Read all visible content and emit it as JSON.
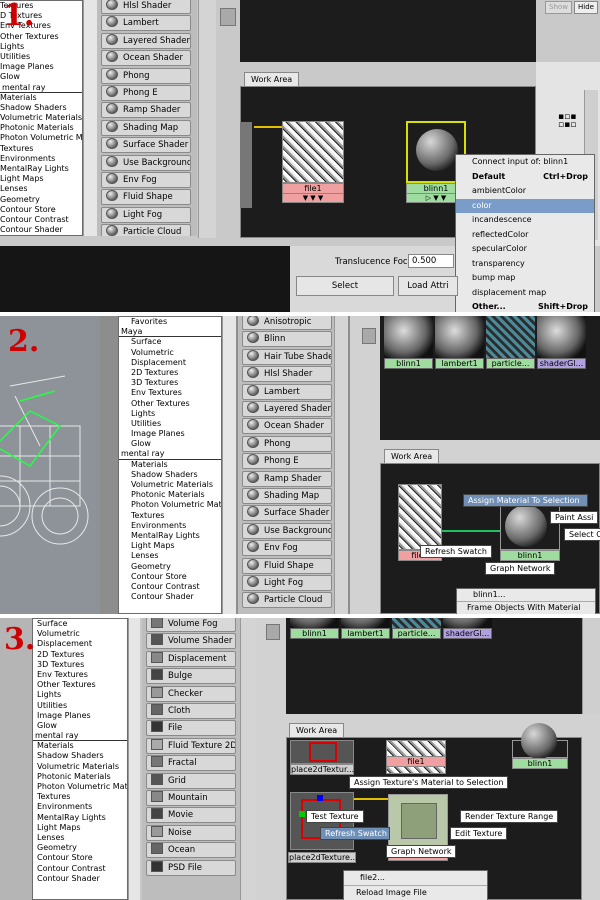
{
  "panel1": {
    "step": "1.",
    "tree": [
      "Textures",
      "D Textures",
      "Env Textures",
      "Other Textures",
      "Lights",
      "Utilities",
      "Image Planes",
      "Glow",
      "mental ray",
      "Materials",
      "Shadow Shaders",
      "Volumetric Materials",
      "Photonic Materials",
      "Photon Volumetric Mat...",
      "Textures",
      "Environments",
      "MentalRay Lights",
      "Light Maps",
      "Lenses",
      "Geometry",
      "Contour Store",
      "Contour Contrast",
      "Contour Shader"
    ],
    "buttons": [
      "Hlsl Shader",
      "Lambert",
      "Layered Shader",
      "Ocean Shader",
      "Phong",
      "Phong E",
      "Ramp Shader",
      "Shading Map",
      "Surface Shader",
      "Use Background",
      "Env Fog",
      "Fluid Shape",
      "Light Fog",
      "Particle Cloud"
    ],
    "top_buttons": [
      "Show",
      "Hide"
    ],
    "work_area": "Work Area",
    "node_file": "file1",
    "node_blinn": "blinn1",
    "menu": {
      "title": "Connect input of: blinn1",
      "default": "Default",
      "default_key": "Ctrl+Drop",
      "items": [
        "ambientColor",
        "color",
        "incandescence",
        "reflectedColor",
        "specularColor",
        "transparency",
        "bump map",
        "displacement map"
      ],
      "other": "Other...",
      "other_key": "Shift+Drop"
    },
    "translucence_label": "Translucence Focus",
    "translucence_value": "0.500",
    "select": "Select",
    "load": "Load Attri"
  },
  "panel2": {
    "step": "2.",
    "tree": [
      "Favorites",
      "Maya",
      "Surface",
      "Volumetric",
      "Displacement",
      "2D Textures",
      "3D Textures",
      "Env Textures",
      "Other Textures",
      "Lights",
      "Utilities",
      "Image Planes",
      "Glow",
      "mental ray",
      "Materials",
      "Shadow Shaders",
      "Volumetric Materials",
      "Photonic Materials",
      "Photon Volumetric Mat...",
      "Textures",
      "Environments",
      "MentalRay Lights",
      "Light Maps",
      "Lenses",
      "Geometry",
      "Contour Store",
      "Contour Contrast",
      "Contour Shader"
    ],
    "buttons": [
      "Anisotropic",
      "Blinn",
      "Hair Tube Shader",
      "Hlsl Shader",
      "Lambert",
      "Layered Shader",
      "Ocean Shader",
      "Phong",
      "Phong E",
      "Ramp Shader",
      "Shading Map",
      "Surface Shader",
      "Use Background",
      "Env Fog",
      "Fluid Shape",
      "Light Fog",
      "Particle Cloud"
    ],
    "swatches": [
      "blinn1",
      "lambert1",
      "particle...",
      "shaderGl..."
    ],
    "work_area": "Work Area",
    "node_file": "file1",
    "node_blinn": "blinn1",
    "tips": {
      "assign": "Assign Material To Selection",
      "paint": "Paint Assi",
      "refresh": "Refresh Swatch",
      "select": "Select O",
      "graph": "Graph Network"
    },
    "menu": [
      "blinn1...",
      "Frame Objects With Material"
    ]
  },
  "panel3": {
    "step": "3.",
    "tree": [
      "Surface",
      "Volumetric",
      "Displacement",
      "2D Textures",
      "3D Textures",
      "Env Textures",
      "Other Textures",
      "Lights",
      "Utilities",
      "Image Planes",
      "Glow",
      "mental ray",
      "Materials",
      "Shadow Shaders",
      "Volumetric Materials",
      "Photonic Materials",
      "Photon Volumetric Mat...",
      "Textures",
      "Environments",
      "MentalRay Lights",
      "Light Maps",
      "Lenses",
      "Geometry",
      "Contour Store",
      "Contour Contrast",
      "Contour Shader"
    ],
    "buttons": [
      "Volume Fog",
      "Volume Shader",
      "Displacement",
      "Bulge",
      "Checker",
      "Cloth",
      "File",
      "Fluid Texture 2D",
      "Fractal",
      "Grid",
      "Mountain",
      "Movie",
      "Noise",
      "Ocean",
      "PSD File"
    ],
    "swatches": [
      "blinn1",
      "lambert1",
      "particle...",
      "shaderGl..."
    ],
    "work_area": "Work Area",
    "nodes": {
      "place_a": "place2dTextur...",
      "file1": "file1",
      "blinn1": "blinn1",
      "place_b": "place2dTexture...",
      "file2": "file2"
    },
    "tips": {
      "assign": "Assign Texture's Material to Selection",
      "test": "Test Texture",
      "refresh": "Refresh Swatch",
      "render": "Render Texture Range",
      "edit": "Edit Texture",
      "graph": "Graph Network"
    },
    "menu": [
      "file2...",
      "Reload Image File"
    ]
  }
}
